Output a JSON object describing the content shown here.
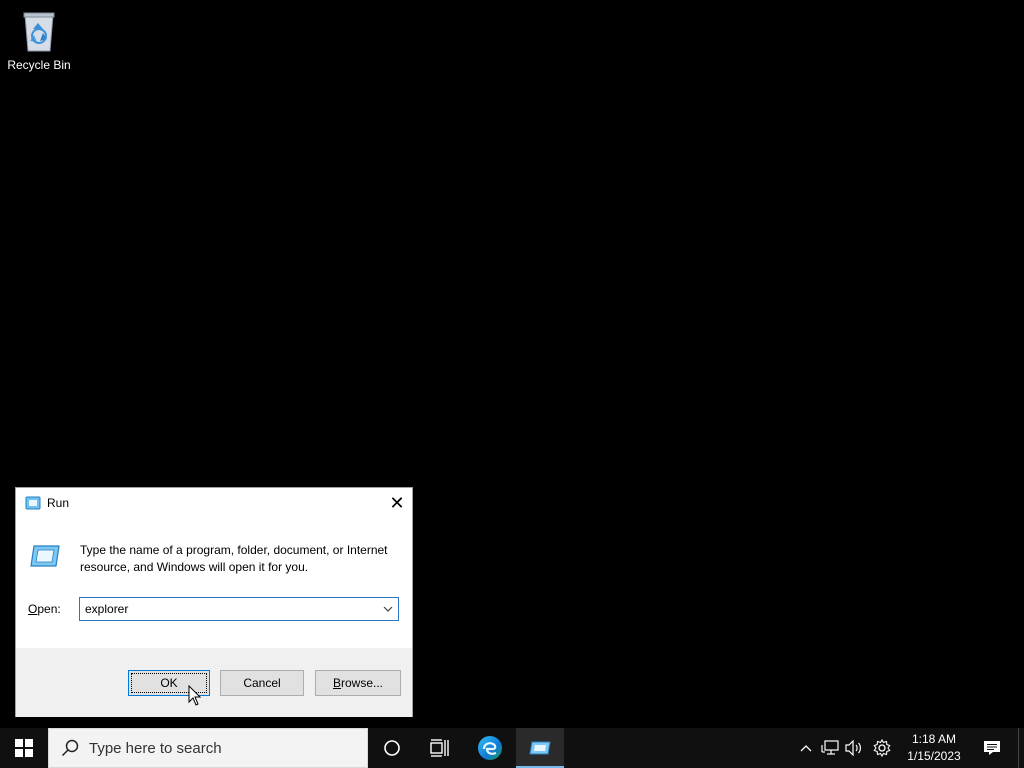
{
  "desktop": {
    "icons": [
      {
        "label": "Recycle Bin",
        "icon": "recycle-bin-icon"
      }
    ]
  },
  "run_dialog": {
    "title": "Run",
    "close_symbol": "✕",
    "description": "Type the name of a program, folder, document, or Internet resource, and Windows will open it for you.",
    "open_label_accel": "O",
    "open_label_rest": "pen:",
    "open_value": "explorer",
    "ok_label": "OK",
    "cancel_label": "Cancel",
    "browse_label_accel": "B",
    "browse_label_rest": "rowse..."
  },
  "taskbar": {
    "search_placeholder": "Type here to search",
    "clock_time": "1:18 AM",
    "clock_date": "1/15/2023",
    "accent_color": "#76b9ed"
  }
}
